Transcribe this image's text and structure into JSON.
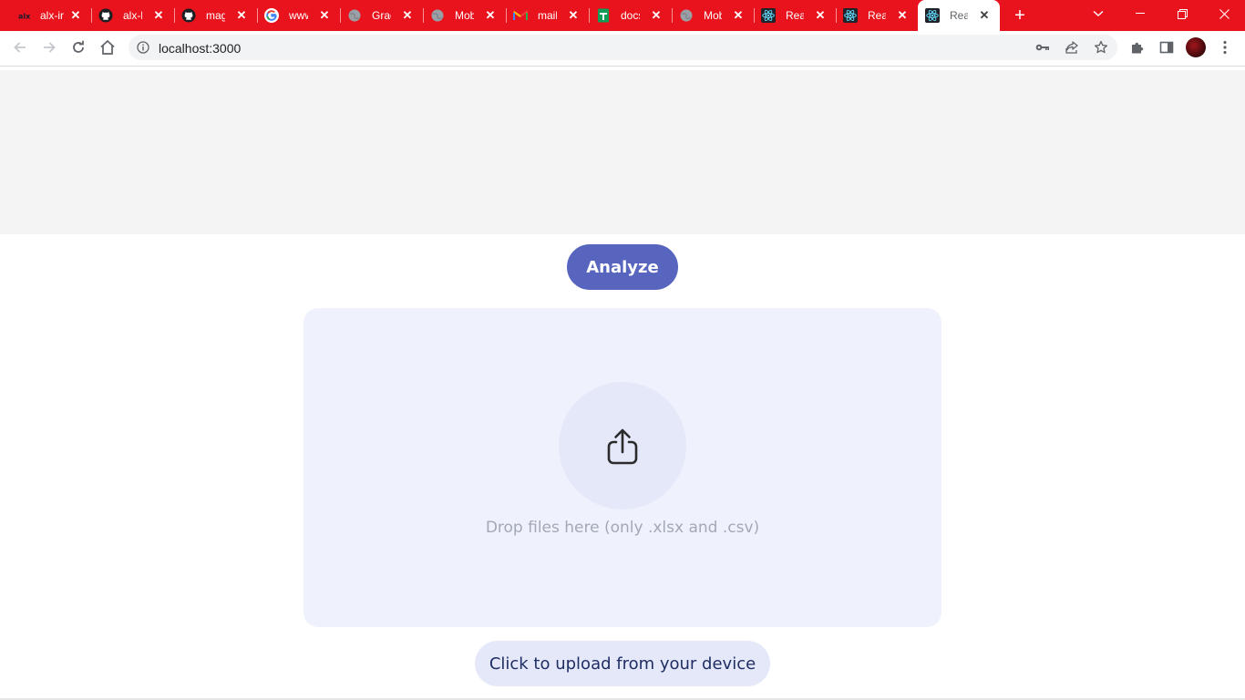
{
  "browser": {
    "tabs": [
      {
        "title": "alx-ir",
        "icon": "alx-icon"
      },
      {
        "title": "alx-lo",
        "icon": "github-icon"
      },
      {
        "title": "magi",
        "icon": "github-icon"
      },
      {
        "title": "www.",
        "icon": "google-icon"
      },
      {
        "title": "Grad",
        "icon": "globe-icon"
      },
      {
        "title": "Mobi",
        "icon": "globe-icon"
      },
      {
        "title": "mail.",
        "icon": "gmail-icon"
      },
      {
        "title": "docs.",
        "icon": "sheets-icon"
      },
      {
        "title": "Mob",
        "icon": "globe-icon"
      },
      {
        "title": "Reac",
        "icon": "react-icon"
      },
      {
        "title": "Reac",
        "icon": "react-icon"
      },
      {
        "title": "Reac",
        "icon": "react-icon",
        "active": true
      }
    ],
    "url": "localhost:3000",
    "accent_color": "#e8131c"
  },
  "page": {
    "analyze_label": "Analyze",
    "dropzone_text": "Drop files here (only .xlsx and .csv)",
    "upload_label": "Click to upload from your device",
    "upload_icon": "share-upload-icon",
    "primary_color": "#5765be"
  }
}
